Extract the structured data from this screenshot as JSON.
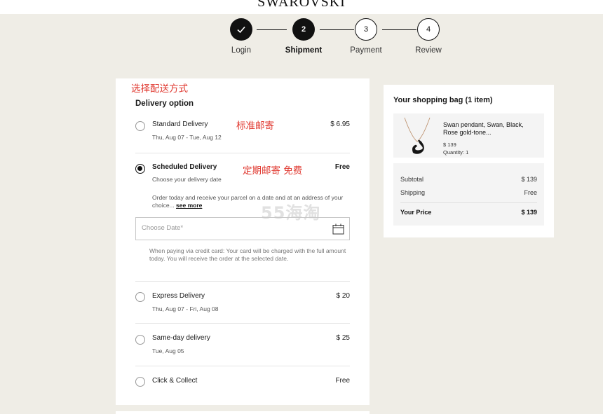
{
  "brand": "SWAROVSKI",
  "steps": [
    {
      "number": "1",
      "label": "Login",
      "state": "done"
    },
    {
      "number": "2",
      "label": "Shipment",
      "state": "active"
    },
    {
      "number": "3",
      "label": "Payment",
      "state": "todo"
    },
    {
      "number": "4",
      "label": "Review",
      "state": "todo"
    }
  ],
  "annotations": {
    "choose_method": "选择配送方式",
    "standard_mail": "标准邮寄",
    "scheduled_free": "定期邮寄 免费"
  },
  "delivery": {
    "title": "Delivery option",
    "options": [
      {
        "name": "Standard Delivery",
        "sub": "Thu, Aug 07 - Tue, Aug 12",
        "price": "$ 6.95",
        "selected": false
      },
      {
        "name": "Scheduled Delivery",
        "sub": "Choose your delivery date",
        "price": "Free",
        "selected": true
      },
      {
        "name": "Express Delivery",
        "sub": "Thu, Aug 07 - Fri, Aug 08",
        "price": "$ 20",
        "selected": false
      },
      {
        "name": "Same-day delivery",
        "sub": "Tue, Aug 05",
        "price": "$ 25",
        "selected": false
      },
      {
        "name": "Click & Collect",
        "sub": "",
        "price": "Free",
        "selected": false
      }
    ],
    "scheduled_note": "Order today and receive your parcel on a date and at an address of your choice...",
    "see_more": "see more",
    "date_placeholder": "Choose Date*",
    "cc_note": "When paying via credit card: Your card will be charged with the full amount today. You will receive the order at the selected date."
  },
  "watermark": "55海淘",
  "bag": {
    "title": "Your shopping bag (1 item)",
    "product": {
      "name": "Swan pendant, Swan, Black, Rose gold-tone...",
      "price": "$ 139",
      "quantity": "Quantity: 1"
    },
    "subtotal_label": "Subtotal",
    "subtotal_value": "$ 139",
    "shipping_label": "Shipping",
    "shipping_value": "Free",
    "total_label": "Your Price",
    "total_value": "$ 139"
  },
  "colors": {
    "background": "#efede6",
    "accent": "#111111",
    "annotation": "#e0382f"
  }
}
